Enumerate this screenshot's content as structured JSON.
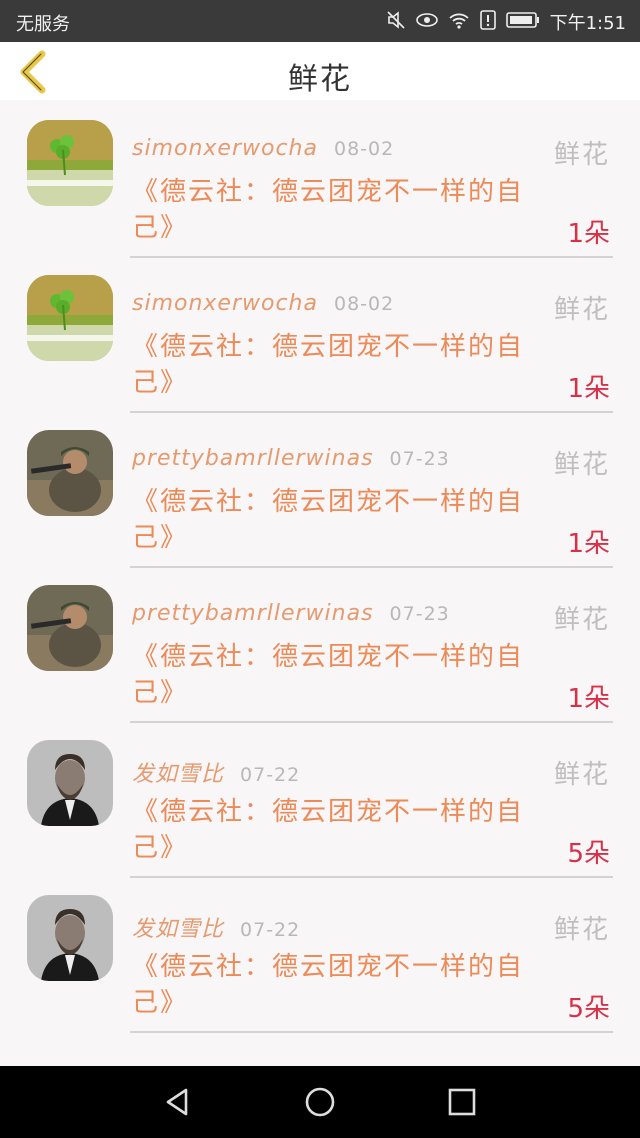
{
  "status": {
    "carrier": "无服务",
    "time": "下午1:51"
  },
  "header": {
    "title": "鲜花"
  },
  "items": [
    {
      "username": "simonxerwocha",
      "date": "08-02",
      "gift": "鲜花",
      "message": "《德云社：德云团宠不一样的自己》",
      "count": "1朵",
      "avatar": "clover"
    },
    {
      "username": "simonxerwocha",
      "date": "08-02",
      "gift": "鲜花",
      "message": "《德云社：德云团宠不一样的自己》",
      "count": "1朵",
      "avatar": "clover"
    },
    {
      "username": "prettybamrllerwinas",
      "date": "07-23",
      "gift": "鲜花",
      "message": "《德云社：德云团宠不一样的自己》",
      "count": "1朵",
      "avatar": "soldier"
    },
    {
      "username": "prettybamrllerwinas",
      "date": "07-23",
      "gift": "鲜花",
      "message": "《德云社：德云团宠不一样的自己》",
      "count": "1朵",
      "avatar": "soldier"
    },
    {
      "username": "发如雪比",
      "date": "07-22",
      "gift": "鲜花",
      "message": "《德云社：德云团宠不一样的自己》",
      "count": "5朵",
      "avatar": "man"
    },
    {
      "username": "发如雪比",
      "date": "07-22",
      "gift": "鲜花",
      "message": "《德云社：德云团宠不一样的自己》",
      "count": "5朵",
      "avatar": "man"
    }
  ],
  "icons": {
    "back": "chevron-left-icon",
    "mute": "mute-icon",
    "eye": "eye-icon",
    "wifi": "wifi-icon",
    "alert": "alert-icon",
    "battery": "battery-icon",
    "nav_back": "triangle-back-icon",
    "nav_home": "circle-home-icon",
    "nav_recent": "square-recent-icon"
  },
  "colors": {
    "accent": "#e69a70",
    "count": "#d9304a",
    "back_icon": "#e8c84a"
  }
}
